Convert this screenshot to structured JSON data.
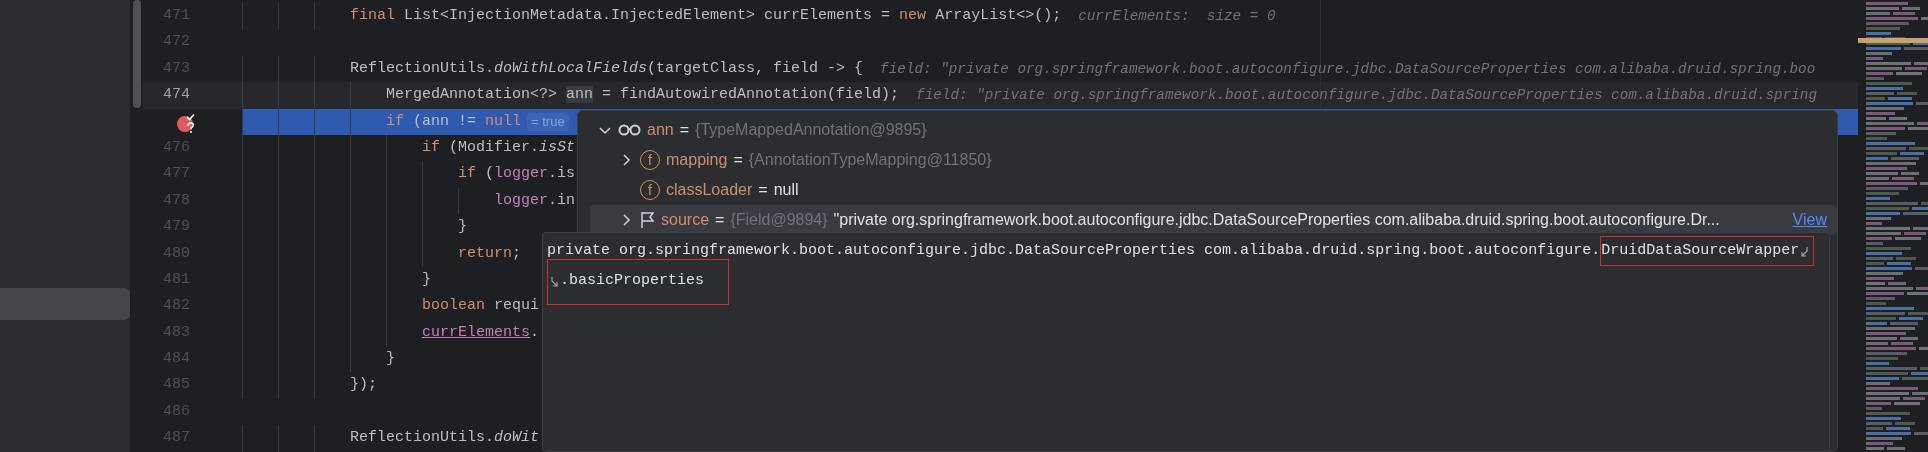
{
  "sidebar": {
    "items": [
      {
        "selected": true
      }
    ]
  },
  "editor": {
    "lines": [
      {
        "number": "471",
        "current": false,
        "breakpoint": false,
        "highlighted": false,
        "tokens": [
          {
            "kind": "keyword",
            "text": "final"
          },
          {
            "kind": "plain",
            "text": " List<InjectionMetadata.InjectedElement> currElements = "
          },
          {
            "kind": "keyword",
            "text": "new"
          },
          {
            "kind": "plain",
            "text": " ArrayList<>();"
          }
        ],
        "hint": "currElements:  size = 0"
      },
      {
        "number": "472",
        "current": false,
        "breakpoint": false,
        "highlighted": false
      },
      {
        "number": "473",
        "current": false,
        "breakpoint": false,
        "highlighted": false,
        "tokens": [
          {
            "kind": "plain",
            "text": "ReflectionUtils."
          },
          {
            "kind": "static",
            "text": "doWithLocalFields"
          },
          {
            "kind": "plain",
            "text": "(targetClass, field -> {"
          }
        ],
        "hint": "field: \"private org.springframework.boot.autoconfigure.jdbc.DataSourceProperties com.alibaba.druid.spring.boo",
        "children": [
          {
            "number": "474",
            "current": true,
            "breakpoint": false,
            "highlighted": false,
            "tokens": [
              {
                "kind": "plain",
                "text": "MergedAnnotation<?> "
              },
              {
                "kind": "reference",
                "text": "ann"
              },
              {
                "kind": "plain",
                "text": " = findAutowiredAnnotation(field);"
              }
            ],
            "hint": "field: \"private org.springframework.boot.autoconfigure.jdbc.DataSourceProperties com.alibaba.druid.spring"
          },
          {
            "current": false,
            "breakpoint": true,
            "highlighted": true,
            "tokens": [
              {
                "kind": "keyword",
                "text": "if"
              },
              {
                "kind": "plain",
                "text": " (ann != "
              },
              {
                "kind": "keyword",
                "text": "null"
              }
            ],
            "inline_value": "= true",
            "children": [
              {
                "number": "476",
                "current": false,
                "breakpoint": false,
                "highlighted": false,
                "tokens": [
                  {
                    "kind": "keyword",
                    "text": "if"
                  },
                  {
                    "kind": "plain",
                    "text": " (Modifier."
                  },
                  {
                    "kind": "static",
                    "text": "isSt"
                  }
                ],
                "children": [
                  {
                    "number": "477",
                    "current": false,
                    "breakpoint": false,
                    "highlighted": false,
                    "tokens": [
                      {
                        "kind": "keyword",
                        "text": "if"
                      },
                      {
                        "kind": "plain",
                        "text": " ("
                      },
                      {
                        "kind": "field",
                        "text": "logger"
                      },
                      {
                        "kind": "plain",
                        "text": ".is"
                      }
                    ],
                    "children": [
                      {
                        "number": "478",
                        "current": false,
                        "breakpoint": false,
                        "highlighted": false,
                        "tokens": [
                          {
                            "kind": "field",
                            "text": "logger"
                          },
                          {
                            "kind": "plain",
                            "text": ".in"
                          }
                        ]
                      }
                    ]
                  },
                  {
                    "number": "479",
                    "current": false,
                    "breakpoint": false,
                    "highlighted": false,
                    "tokens": [
                      {
                        "kind": "plain",
                        "text": "}"
                      }
                    ]
                  },
                  {
                    "number": "480",
                    "current": false,
                    "breakpoint": false,
                    "highlighted": false,
                    "tokens": [
                      {
                        "kind": "keyword",
                        "text": "return"
                      },
                      {
                        "kind": "plain",
                        "text": ";"
                      }
                    ]
                  }
                ]
              },
              {
                "number": "481",
                "current": false,
                "breakpoint": false,
                "highlighted": false,
                "tokens": [
                  {
                    "kind": "plain",
                    "text": "}"
                  }
                ]
              },
              {
                "number": "482",
                "current": false,
                "breakpoint": false,
                "highlighted": false,
                "tokens": [
                  {
                    "kind": "keyword",
                    "text": "boolean"
                  },
                  {
                    "kind": "plain",
                    "text": " requi"
                  }
                ]
              },
              {
                "number": "483",
                "current": false,
                "breakpoint": false,
                "highlighted": false,
                "tokens": [
                  {
                    "kind": "field_underlined",
                    "text": "currElements"
                  },
                  {
                    "kind": "plain",
                    "text": "."
                  }
                ]
              }
            ]
          },
          {
            "number": "484",
            "current": false,
            "breakpoint": false,
            "highlighted": false,
            "tokens": [
              {
                "kind": "plain",
                "text": "}"
              }
            ]
          }
        ]
      },
      {
        "number": "485",
        "current": false,
        "breakpoint": false,
        "highlighted": false,
        "tokens": [
          {
            "kind": "plain",
            "text": "});"
          }
        ]
      },
      {
        "number": "486",
        "current": false,
        "breakpoint": false,
        "highlighted": false
      },
      {
        "number": "487",
        "current": false,
        "breakpoint": false,
        "highlighted": false,
        "tokens": [
          {
            "kind": "plain",
            "text": "ReflectionUtils."
          },
          {
            "kind": "static",
            "text": "doWit"
          }
        ]
      }
    ]
  },
  "debug_popup": {
    "variables": [
      {
        "name": "ann",
        "kind": "watch",
        "expanded": true,
        "selected": false,
        "operator": "=",
        "value": "{TypeMappedAnnotation@9895}",
        "children": [
          {
            "name": "mapping",
            "kind": "field",
            "badge": "f",
            "expanded": false,
            "selected": false,
            "operator": "=",
            "value": "{AnnotationTypeMapping@11850}"
          },
          {
            "name": "classLoader",
            "kind": "field",
            "badge": "f",
            "selected": false,
            "operator": "=",
            "literal": "null"
          },
          {
            "name": "source",
            "kind": "flag",
            "expanded": false,
            "selected": true,
            "operator": "=",
            "value": "{Field@9894}",
            "detail": "\"private org.springframework.boot.autoconfigure.jdbc.DataSourceProperties com.alibaba.druid.spring.boot.autoconfigure.Dr...",
            "link": "View"
          }
        ]
      }
    ]
  },
  "tooltip": {
    "lines": [
      {
        "text": "private org.springframework.boot.autoconfigure.jdbc.DataSourceProperties com.alibaba.druid.spring.boot.autoconfigure.",
        "marked": "DruidDataSourceWrapper",
        "wraps": true,
        "continued": false
      },
      {
        "marked": ".basicProperties",
        "wraps": false,
        "continued": true
      }
    ]
  }
}
